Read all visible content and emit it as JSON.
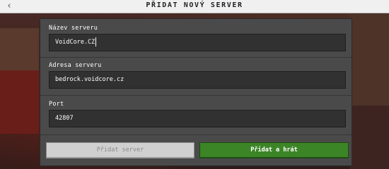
{
  "header": {
    "title": "PŘIDAT NOVÝ SERVER",
    "back_icon": "‹"
  },
  "form": {
    "server_name": {
      "label": "Název serveru",
      "value": "VoidCore.CZ"
    },
    "server_address": {
      "label": "Adresa serveru",
      "value": "bedrock.voidcore.cz"
    },
    "port": {
      "label": "Port",
      "value": "42807"
    }
  },
  "buttons": {
    "add_server": "Přidat server",
    "add_and_play": "Přidat a hrát"
  },
  "colors": {
    "panel": "#4a4a4a",
    "input": "#313131",
    "primary_button": "#3c8527",
    "disabled_button": "#d0d0d0"
  }
}
